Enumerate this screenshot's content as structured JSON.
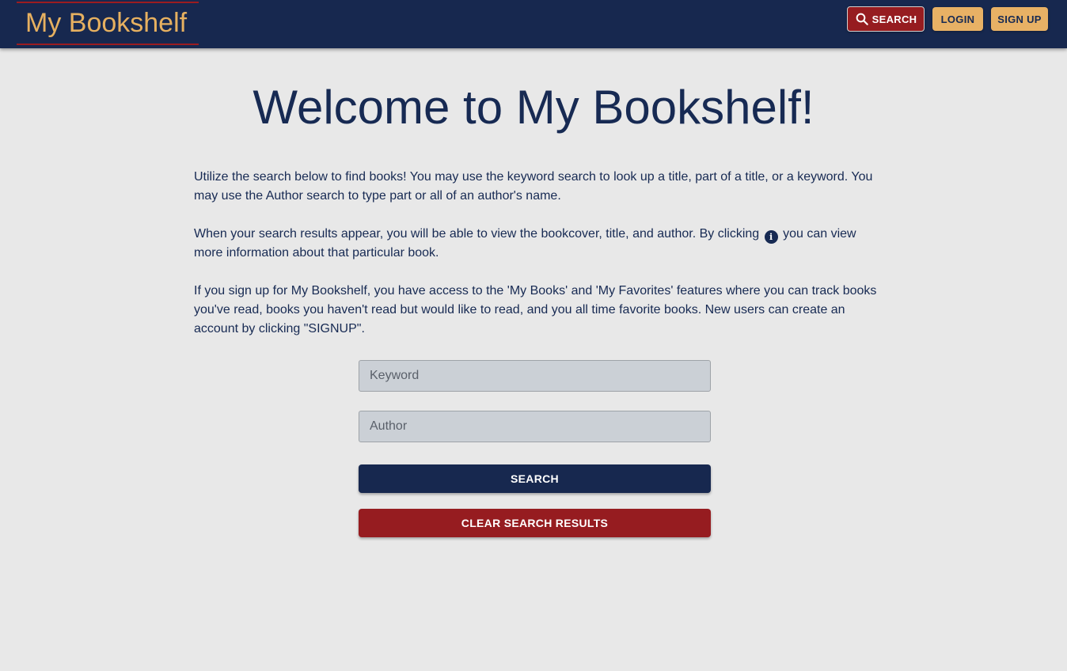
{
  "header": {
    "brand": "My Bookshelf",
    "search_label": "SEARCH",
    "login_label": "LOGIN",
    "signup_label": "SIGN UP",
    "search_icon": "magnifier-icon"
  },
  "main": {
    "title": "Welcome to My Bookshelf!",
    "paragraph1": "Utilize the search below to find books! You may use the keyword search to look up a title, part of a title, or a keyword. You may use the Author search to type part or all of an author's name.",
    "paragraph2_before": "When your search results appear, you will be able to view the bookcover, title, and author. By clicking",
    "paragraph2_icon": "info-icon",
    "paragraph2_after": "you can view more information about that particular book.",
    "paragraph3": "If you sign up for My Bookshelf, you have access to the 'My Books' and 'My Favorites' features where you can track books you've read, books you haven't read but would like to read, and you all time favorite books. New users can create an account by clicking \"SIGNUP\"."
  },
  "search_form": {
    "keyword_placeholder": "Keyword",
    "keyword_value": "",
    "author_placeholder": "Author",
    "author_value": "",
    "search_button": "SEARCH",
    "clear_button": "CLEAR SEARCH RESULTS"
  },
  "colors": {
    "navy": "#17284f",
    "crimson": "#961c20",
    "gold": "#e8b165",
    "background": "#e8e8e8"
  }
}
